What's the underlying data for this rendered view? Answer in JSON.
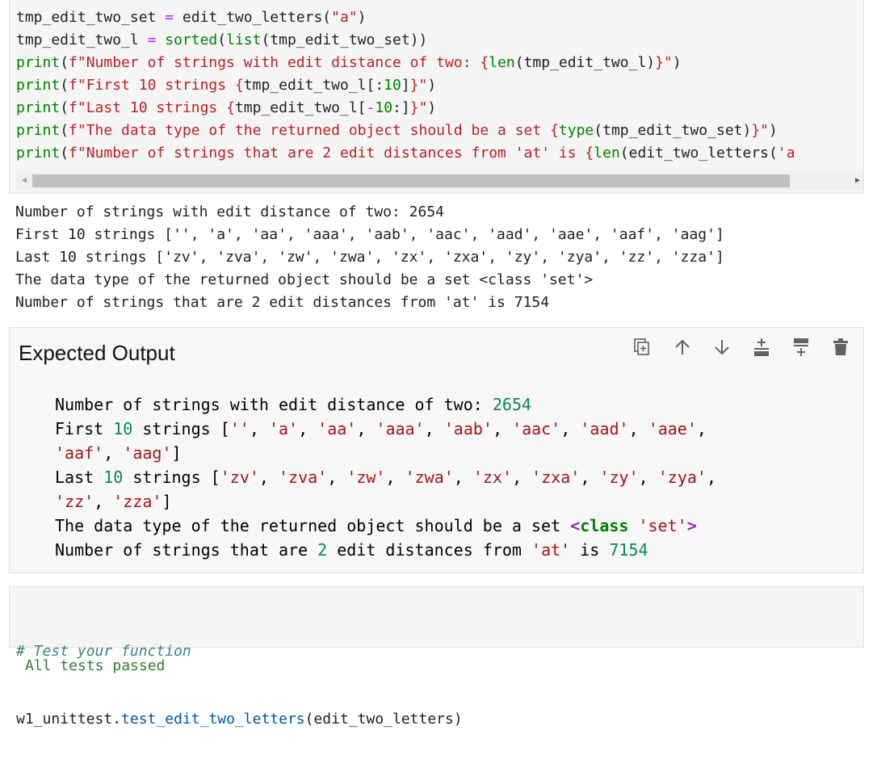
{
  "code_cell_1": {
    "lines": [
      [
        {
          "t": "tmp_edit_two_set ",
          "c": "pl"
        },
        {
          "t": "=",
          "c": "op"
        },
        {
          "t": " edit_two_letters(",
          "c": "pl"
        },
        {
          "t": "\"a\"",
          "c": "str"
        },
        {
          "t": ")",
          "c": "pl"
        }
      ],
      [
        {
          "t": "tmp_edit_two_l ",
          "c": "pl"
        },
        {
          "t": "=",
          "c": "op"
        },
        {
          "t": " ",
          "c": "pl"
        },
        {
          "t": "sorted",
          "c": "bi"
        },
        {
          "t": "(",
          "c": "pl"
        },
        {
          "t": "list",
          "c": "bi"
        },
        {
          "t": "(tmp_edit_two_set))",
          "c": "pl"
        }
      ],
      [
        {
          "t": "print",
          "c": "bi"
        },
        {
          "t": "(",
          "c": "pl"
        },
        {
          "t": "f\"Number of strings with edit distance of two: ",
          "c": "str"
        },
        {
          "t": "{",
          "c": "str"
        },
        {
          "t": "len",
          "c": "bi"
        },
        {
          "t": "(tmp_edit_two_l)",
          "c": "pl"
        },
        {
          "t": "}\"",
          "c": "str"
        },
        {
          "t": ")",
          "c": "pl"
        }
      ],
      [
        {
          "t": "print",
          "c": "bi"
        },
        {
          "t": "(",
          "c": "pl"
        },
        {
          "t": "f\"First 10 strings ",
          "c": "str"
        },
        {
          "t": "{",
          "c": "str"
        },
        {
          "t": "tmp_edit_two_l[:",
          "c": "pl"
        },
        {
          "t": "10",
          "c": "num"
        },
        {
          "t": "]",
          "c": "pl"
        },
        {
          "t": "}\"",
          "c": "str"
        },
        {
          "t": ")",
          "c": "pl"
        }
      ],
      [
        {
          "t": "print",
          "c": "bi"
        },
        {
          "t": "(",
          "c": "pl"
        },
        {
          "t": "f\"Last 10 strings ",
          "c": "str"
        },
        {
          "t": "{",
          "c": "str"
        },
        {
          "t": "tmp_edit_two_l[",
          "c": "pl"
        },
        {
          "t": "-",
          "c": "op"
        },
        {
          "t": "10",
          "c": "num"
        },
        {
          "t": ":]",
          "c": "pl"
        },
        {
          "t": "}\"",
          "c": "str"
        },
        {
          "t": ")",
          "c": "pl"
        }
      ],
      [
        {
          "t": "print",
          "c": "bi"
        },
        {
          "t": "(",
          "c": "pl"
        },
        {
          "t": "f\"The data type of the returned object should be a set ",
          "c": "str"
        },
        {
          "t": "{",
          "c": "str"
        },
        {
          "t": "type",
          "c": "bi"
        },
        {
          "t": "(tmp_edit_two_set)",
          "c": "pl"
        },
        {
          "t": "}\"",
          "c": "str"
        },
        {
          "t": ")",
          "c": "pl"
        }
      ],
      [
        {
          "t": "print",
          "c": "bi"
        },
        {
          "t": "(",
          "c": "pl"
        },
        {
          "t": "f\"Number of strings that are 2 edit distances from 'at' is ",
          "c": "str"
        },
        {
          "t": "{",
          "c": "str"
        },
        {
          "t": "len",
          "c": "bi"
        },
        {
          "t": "(edit_two_letters(",
          "c": "pl"
        },
        {
          "t": "'a",
          "c": "str"
        }
      ]
    ]
  },
  "output_1": [
    "Number of strings with edit distance of two: 2654",
    "First 10 strings ['', 'a', 'aa', 'aaa', 'aab', 'aac', 'aad', 'aae', 'aaf', 'aag']",
    "Last 10 strings ['zv', 'zva', 'zw', 'zwa', 'zx', 'zxa', 'zy', 'zya', 'zz', 'zza']",
    "The data type of the returned object should be a set <class 'set'>",
    "Number of strings that are 2 edit distances from 'at' is 7154"
  ],
  "markdown_cell": {
    "title": "Expected Output",
    "toolbar": [
      "duplicate-icon",
      "move-up-icon",
      "move-down-icon",
      "insert-above-icon",
      "insert-below-icon",
      "delete-icon"
    ],
    "lines": [
      [
        {
          "t": "Number of strings with edit distance of two: ",
          "c": "pl"
        },
        {
          "t": "2654",
          "c": "num"
        }
      ],
      [
        {
          "t": "First ",
          "c": "pl"
        },
        {
          "t": "10",
          "c": "num"
        },
        {
          "t": " strings [",
          "c": "pl"
        },
        {
          "t": "''",
          "c": "str"
        },
        {
          "t": ", ",
          "c": "pl"
        },
        {
          "t": "'a'",
          "c": "str"
        },
        {
          "t": ", ",
          "c": "pl"
        },
        {
          "t": "'aa'",
          "c": "str"
        },
        {
          "t": ", ",
          "c": "pl"
        },
        {
          "t": "'aaa'",
          "c": "str"
        },
        {
          "t": ", ",
          "c": "pl"
        },
        {
          "t": "'aab'",
          "c": "str"
        },
        {
          "t": ", ",
          "c": "pl"
        },
        {
          "t": "'aac'",
          "c": "str"
        },
        {
          "t": ", ",
          "c": "pl"
        },
        {
          "t": "'aad'",
          "c": "str"
        },
        {
          "t": ", ",
          "c": "pl"
        },
        {
          "t": "'aae'",
          "c": "str"
        },
        {
          "t": ",",
          "c": "pl"
        }
      ],
      [
        {
          "t": "'aaf'",
          "c": "str"
        },
        {
          "t": ", ",
          "c": "pl"
        },
        {
          "t": "'aag'",
          "c": "str"
        },
        {
          "t": "]",
          "c": "pl"
        }
      ],
      [
        {
          "t": "Last ",
          "c": "pl"
        },
        {
          "t": "10",
          "c": "num"
        },
        {
          "t": " strings [",
          "c": "pl"
        },
        {
          "t": "'zv'",
          "c": "str"
        },
        {
          "t": ", ",
          "c": "pl"
        },
        {
          "t": "'zva'",
          "c": "str"
        },
        {
          "t": ", ",
          "c": "pl"
        },
        {
          "t": "'zw'",
          "c": "str"
        },
        {
          "t": ", ",
          "c": "pl"
        },
        {
          "t": "'zwa'",
          "c": "str"
        },
        {
          "t": ", ",
          "c": "pl"
        },
        {
          "t": "'zx'",
          "c": "str"
        },
        {
          "t": ", ",
          "c": "pl"
        },
        {
          "t": "'zxa'",
          "c": "str"
        },
        {
          "t": ", ",
          "c": "pl"
        },
        {
          "t": "'zy'",
          "c": "str"
        },
        {
          "t": ", ",
          "c": "pl"
        },
        {
          "t": "'zya'",
          "c": "str"
        },
        {
          "t": ",",
          "c": "pl"
        }
      ],
      [
        {
          "t": "'zz'",
          "c": "str"
        },
        {
          "t": ", ",
          "c": "pl"
        },
        {
          "t": "'zza'",
          "c": "str"
        },
        {
          "t": "]",
          "c": "pl"
        }
      ],
      [
        {
          "t": "The data type of the returned object should be a set ",
          "c": "pl"
        },
        {
          "t": "<",
          "c": "pur"
        },
        {
          "t": "class",
          "c": "kw"
        },
        {
          "t": " ",
          "c": "pl"
        },
        {
          "t": "'set'",
          "c": "str"
        },
        {
          "t": ">",
          "c": "pur"
        }
      ],
      [
        {
          "t": "Number of strings that are ",
          "c": "pl"
        },
        {
          "t": "2",
          "c": "num"
        },
        {
          "t": " edit distances from ",
          "c": "pl"
        },
        {
          "t": "'at'",
          "c": "str"
        },
        {
          "t": " is ",
          "c": "pl"
        },
        {
          "t": "7154",
          "c": "num"
        }
      ]
    ]
  },
  "code_cell_2": {
    "comment": "# Test your function",
    "call_prefix": "w1_unittest.",
    "call_func": "test_edit_two_letters",
    "call_args": "(edit_two_letters)"
  },
  "output_2": "All tests passed",
  "colors": {
    "code_str": "#ba2121",
    "code_builtin": "#008000",
    "code_op": "#aa22ff",
    "md_num": "#098658",
    "md_str": "#a31515",
    "comment": "#408080",
    "pass": "#2e7d32"
  }
}
